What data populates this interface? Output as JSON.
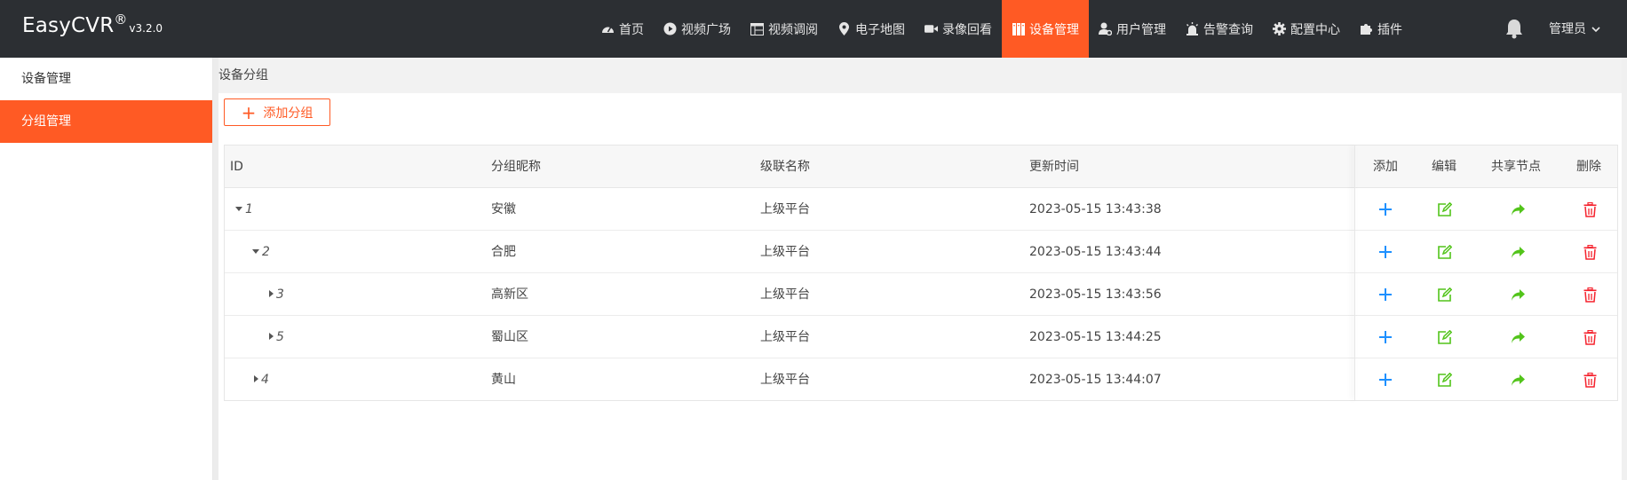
{
  "brand": {
    "name": "EasyCVR",
    "reg": "®",
    "version": "v3.2.0"
  },
  "nav": [
    {
      "label": "首页",
      "icon": "dashboard-icon"
    },
    {
      "label": "视频广场",
      "icon": "play-circle-icon"
    },
    {
      "label": "视频调阅",
      "icon": "grid-icon"
    },
    {
      "label": "电子地图",
      "icon": "map-marker-icon"
    },
    {
      "label": "录像回看",
      "icon": "video-camera-icon"
    },
    {
      "label": "设备管理",
      "icon": "device-icon"
    },
    {
      "label": "用户管理",
      "icon": "user-gear-icon"
    },
    {
      "label": "告警查询",
      "icon": "alarm-icon"
    },
    {
      "label": "配置中心",
      "icon": "gear-icon"
    },
    {
      "label": "插件",
      "icon": "puzzle-icon"
    }
  ],
  "user": {
    "label": "管理员"
  },
  "sidebar": {
    "items": [
      {
        "label": "设备管理"
      },
      {
        "label": "分组管理"
      }
    ]
  },
  "breadcrumb": {
    "label": "设备分组"
  },
  "toolbar": {
    "add_label": "添加分组"
  },
  "table": {
    "headers": {
      "id": "ID",
      "name": "分组昵称",
      "cascade": "级联名称",
      "updated": "更新时间",
      "add": "添加",
      "edit": "编辑",
      "share": "共享节点",
      "delete": "删除"
    },
    "rows": [
      {
        "id": "1",
        "name": "安徽",
        "cascade": "上级平台",
        "updated": "2023-05-15 13:43:38"
      },
      {
        "id": "2",
        "name": "合肥",
        "cascade": "上级平台",
        "updated": "2023-05-15 13:43:44"
      },
      {
        "id": "3",
        "name": "高新区",
        "cascade": "上级平台",
        "updated": "2023-05-15 13:43:56"
      },
      {
        "id": "5",
        "name": "蜀山区",
        "cascade": "上级平台",
        "updated": "2023-05-15 13:44:25"
      },
      {
        "id": "4",
        "name": "黄山",
        "cascade": "上级平台",
        "updated": "2023-05-15 13:44:07"
      }
    ]
  },
  "colors": {
    "accent": "#ff5a24",
    "topbar": "#2c2f33",
    "add_action": "#1e90ff",
    "edit_action": "#52c41a",
    "delete_action": "#f5222d"
  }
}
